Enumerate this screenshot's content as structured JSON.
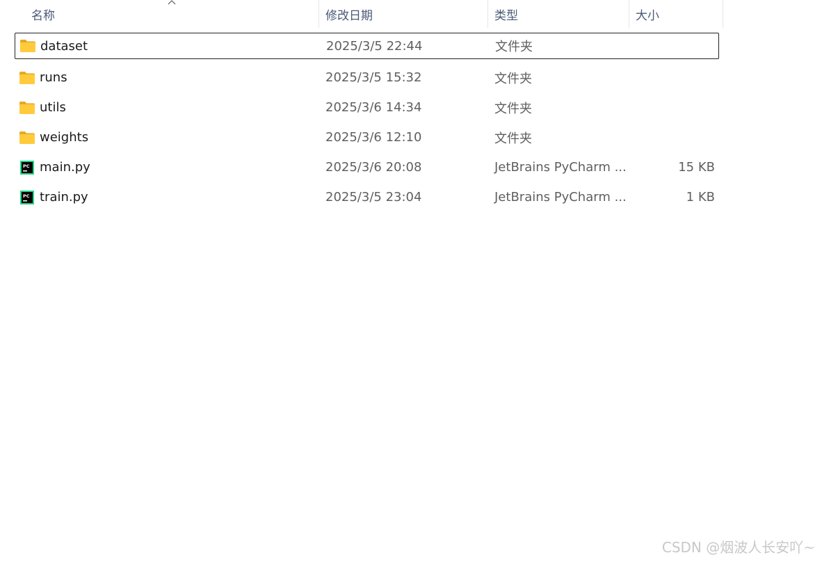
{
  "columns": {
    "name": "名称",
    "date": "修改日期",
    "type": "类型",
    "size": "大小"
  },
  "sort": {
    "column": "name",
    "icon": "chevron-up-icon"
  },
  "files": [
    {
      "name": "dataset",
      "date": "2025/3/5 22:44",
      "type": "文件夹",
      "size": "",
      "icon": "folder-icon",
      "focused": true
    },
    {
      "name": "runs",
      "date": "2025/3/5 15:32",
      "type": "文件夹",
      "size": "",
      "icon": "folder-icon"
    },
    {
      "name": "utils",
      "date": "2025/3/6 14:34",
      "type": "文件夹",
      "size": "",
      "icon": "folder-icon"
    },
    {
      "name": "weights",
      "date": "2025/3/6 12:10",
      "type": "文件夹",
      "size": "",
      "icon": "folder-icon"
    },
    {
      "name": "main.py",
      "date": "2025/3/6 20:08",
      "type": "JetBrains PyCharm ...",
      "size": "15 KB",
      "icon": "pycharm-icon"
    },
    {
      "name": "train.py",
      "date": "2025/3/5 23:04",
      "type": "JetBrains PyCharm ...",
      "size": "1 KB",
      "icon": "pycharm-icon"
    }
  ],
  "colors": {
    "folder": "#FFCB3D",
    "folder_dark": "#E8A820",
    "pycharm_bg": "#000000",
    "pycharm_green": "#21D789",
    "header_text": "#4a5a76"
  },
  "watermark": "CSDN @烟波人长安吖~"
}
